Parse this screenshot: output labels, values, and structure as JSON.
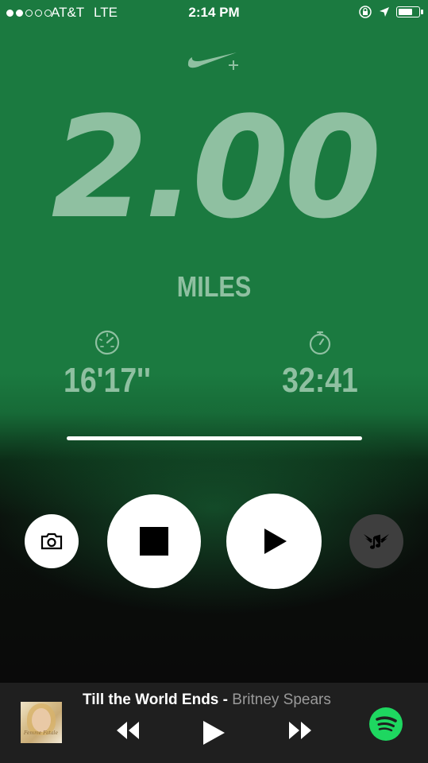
{
  "status_bar": {
    "signal_dots_filled": 2,
    "signal_dots_total": 5,
    "carrier": "AT&T",
    "network": "LTE",
    "time": "2:14 PM",
    "battery_level": 0.75
  },
  "run": {
    "distance": "2.00",
    "unit": "MILES",
    "pace": "16'17''",
    "duration": "32:41",
    "progress": 1.0
  },
  "controls": {
    "camera_icon": "camera-icon",
    "stop_icon": "stop-icon",
    "play_icon": "play-icon",
    "share_icon": "winged-music-note-icon"
  },
  "now_playing": {
    "title": "Till the World Ends",
    "separator": " - ",
    "artist": "Britney Spears",
    "album_art_text": "Femme Fatale"
  },
  "colors": {
    "background_green": "#1b7a40",
    "stat_text": "#8fc0a1",
    "spotify_green": "#1ed760"
  }
}
